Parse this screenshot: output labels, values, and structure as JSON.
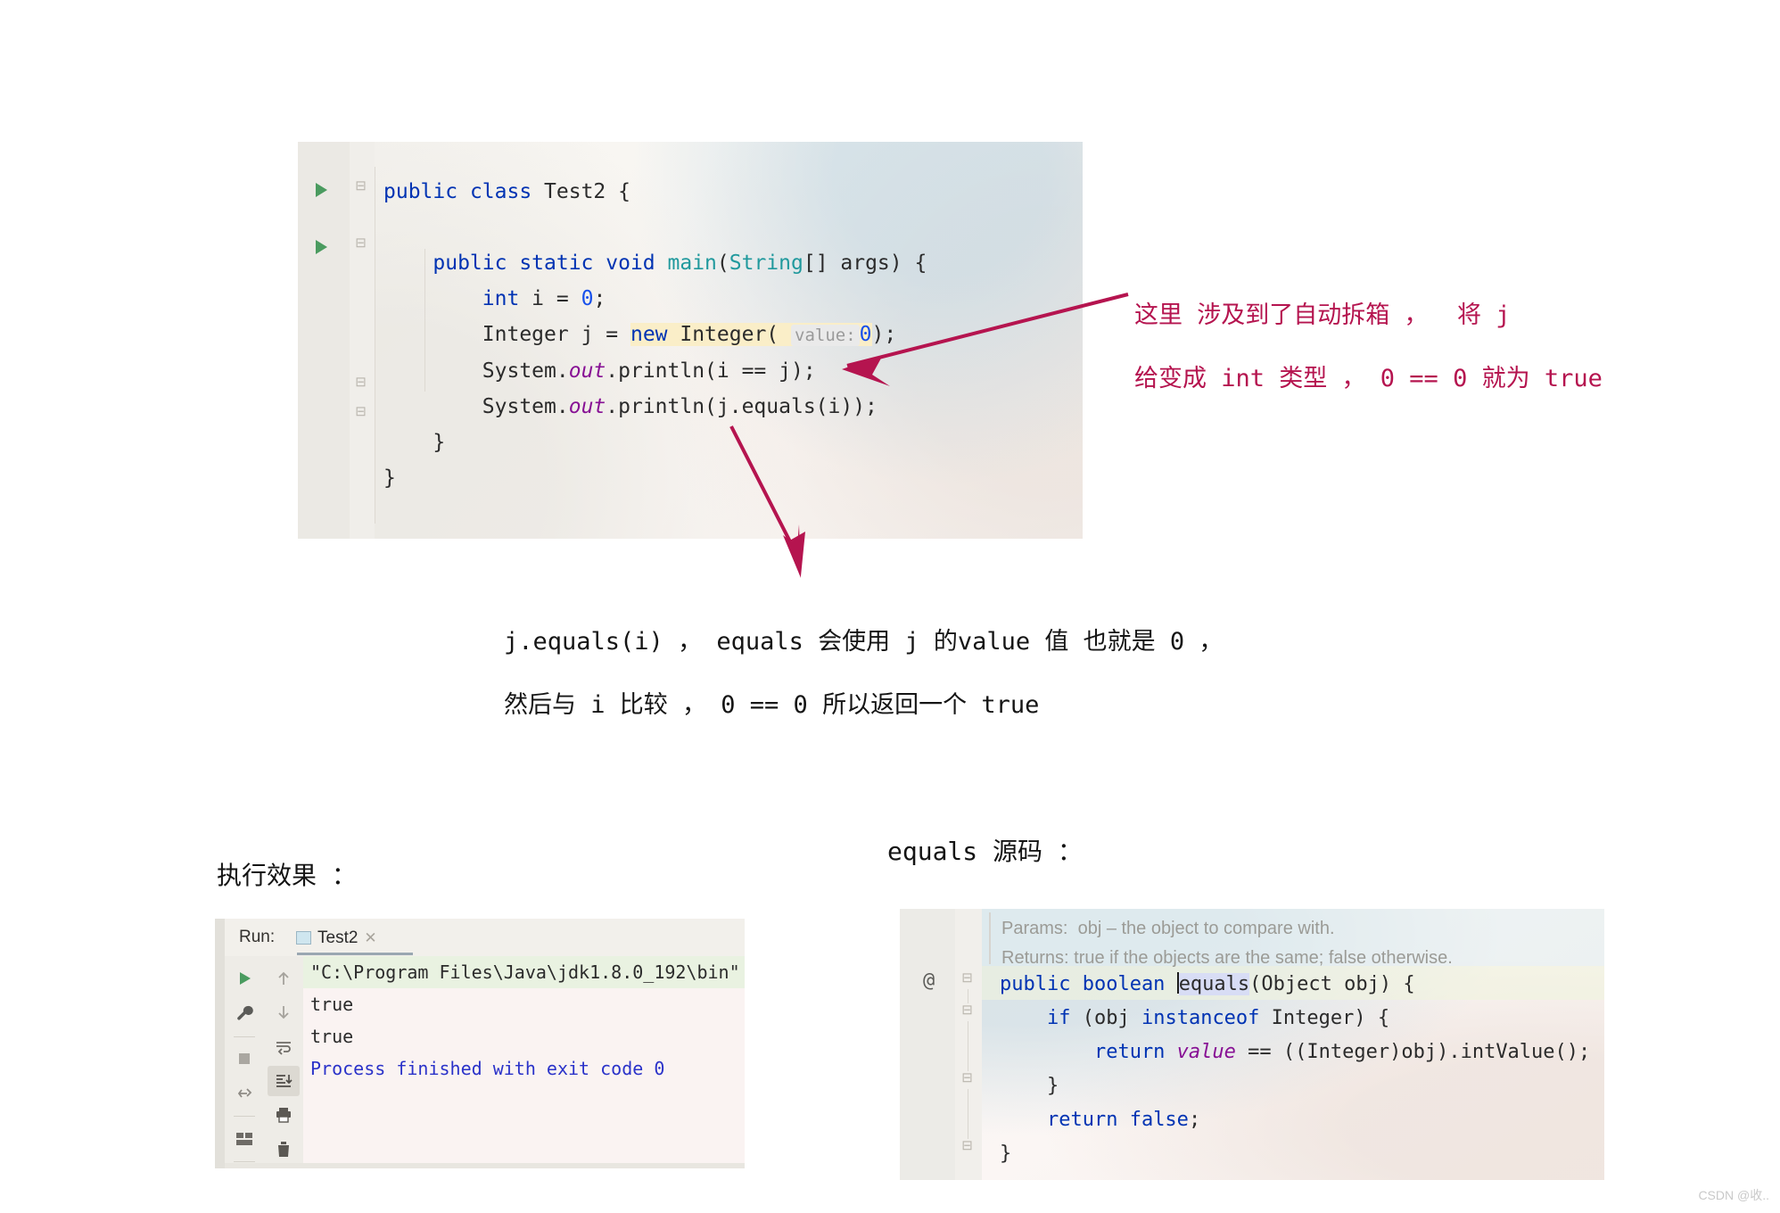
{
  "editor": {
    "gutter": {
      "run_arrow_1": "run-gutter-arrow",
      "run_arrow_2": "run-gutter-arrow",
      "fold_markers": [
        "minus",
        "minus",
        "minus",
        "minus"
      ]
    },
    "code": {
      "line1_a": "public",
      "line1_b": " class ",
      "line1_c": "Test2",
      "line1_d": " {",
      "line3_a": "public static void ",
      "line3_b": "main",
      "line3_c": "(",
      "line3_d": "String",
      "line3_e": "[] args) {",
      "line4_a": "int",
      "line4_b": " i = ",
      "line4_c": "0",
      "line4_d": ";",
      "line5_a": "Integer",
      "line5_b": " j = ",
      "line5_c": "new",
      "line5_d": " Integer( ",
      "line5_hint": "value:",
      "line5_e": "0",
      "line5_f": ");",
      "line6_a": "System.",
      "line6_b": "out",
      "line6_c": ".println(i == j);",
      "line7_a": "System.",
      "line7_b": "out",
      "line7_c": ".println(j.equals(i));",
      "line8": "}",
      "line9": "}"
    }
  },
  "annotations": {
    "right_line1": "这里 涉及到了自动拆箱 ，  将 j",
    "right_line2": "给变成 int 类型 ， 0 == 0 就为 true",
    "right_color": "#b5144f",
    "center_line1": "j.equals(i) ， equals 会使用 j 的value 值 也就是 0 ，",
    "center_line2": "然后与 i 比较 ， 0 == 0 所以返回一个 true",
    "center_color": "#151515"
  },
  "headings": {
    "run_section": "执行效果 ：",
    "equals_section": "equals 源码 ："
  },
  "run_console": {
    "label": "Run:",
    "tab_name": "Test2",
    "tab_close": "✕",
    "toolbar_left": [
      "run-icon",
      "wrench-icon",
      "stop-icon",
      "debug-restore-icon",
      "layout-icon"
    ],
    "toolbar_right": [
      "arrow-up-icon",
      "arrow-down-icon",
      "soft-wrap-icon",
      "scroll-to-end-icon",
      "print-icon",
      "trash-icon"
    ],
    "lines": [
      "\"C:\\Program Files\\Java\\jdk1.8.0_192\\bin\"",
      "true",
      "true",
      "",
      "Process finished with exit code 0"
    ],
    "cmd_bg": "#e9f2e1",
    "exit_color": "#2a32c9"
  },
  "equals_source": {
    "at_annotation": "@",
    "doc_params": "Params:  obj – the object to compare with.",
    "doc_returns": "Returns: true if the objects are the same; false otherwise.",
    "sig_a": "public boolean ",
    "sig_word": "equals",
    "sig_b": "(Object obj) {",
    "if_a": "    if",
    "if_b": " (obj ",
    "if_c": "instanceof",
    "if_d": " Integer) {",
    "ret_a": "        return",
    "ret_b": " value",
    "ret_c": " == ((Integer)obj).intValue();",
    "close_inner": "    }",
    "ret2_a": "    return",
    "ret2_b": " false",
    "ret2_c": ";",
    "close_outer": "}"
  },
  "watermark": "CSDN @收..",
  "colors": {
    "keyword": "#0033b3",
    "type": "#20999d",
    "number": "#1750eb",
    "field": "#871094",
    "plain": "#2b2b2b",
    "highlight": "#faeec8",
    "annotation_pink": "#b5144f"
  }
}
